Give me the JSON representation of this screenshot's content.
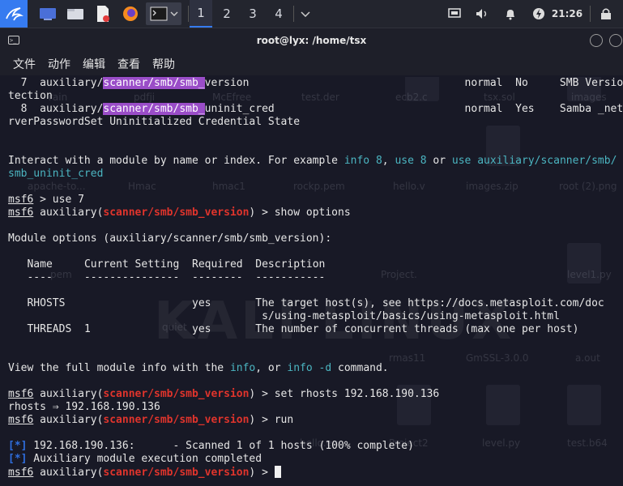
{
  "panel": {
    "workspaces": [
      "1",
      "2",
      "3",
      "4"
    ],
    "clock": "21:26"
  },
  "window": {
    "title": "root@lyx: /home/tsx",
    "menu": [
      "文件",
      "动作",
      "编辑",
      "查看",
      "帮助"
    ]
  },
  "terminal": {
    "l1_a": "  7  auxiliary/",
    "l1_b": "scanner/smb/smb_",
    "l1_c": "version                                  normal  No     SMB Version De",
    "l2": "tection",
    "l3_a": "  8  auxiliary/",
    "l3_b": "scanner/smb/smb_",
    "l3_c": "uninit_cred                              normal  Yes    Samba _netr_Se",
    "l4": "rverPasswordSet Uninitialized Credential State",
    "interact_a": "Interact with a module by name or index. For example ",
    "interact_info": "info 8",
    "interact_b": ", ",
    "interact_use": "use 8",
    "interact_c": " or ",
    "interact_use2": "use auxiliary/scanner/smb/",
    "interact_use2b": "smb_uninit_cred",
    "prompt": "msf6",
    "cmd_use7": " > use 7",
    "aux_open": " auxiliary(",
    "module": "scanner/smb/smb_version",
    "aux_close": ") > ",
    "cmd_show": "show options",
    "mod_opts": "Module options (auxiliary/scanner/smb/smb_version):",
    "th_name": "Name",
    "th_setting": "Current Setting",
    "th_required": "Required",
    "th_desc": "Description",
    "sep_row": "   ----     ---------------  --------  -----------",
    "r1_name": "RHOSTS",
    "r1_setting": "",
    "r1_required": "yes",
    "r1_desc_a": "The target host(s), see https://docs.metasploit.com/doc",
    "r1_desc_b": "s/using-metasploit/basics/using-metasploit.html",
    "r2_name": "THREADS",
    "r2_setting": "1",
    "r2_required": "yes",
    "r2_desc": "The number of concurrent threads (max one per host)",
    "view_a": "View the full module info with the ",
    "view_info": "info",
    "view_b": ", or ",
    "view_info_d": "info -d",
    "view_c": " command.",
    "cmd_set": "set rhosts 192.168.190.136",
    "rhosts_echo": "rhosts ⇒ 192.168.190.136",
    "cmd_run": "run",
    "star": "[*]",
    "scan_line": " 192.168.190.136:      - Scanned 1 of 1 hosts (100% complete)",
    "done_line": " Auxiliary module execution completed"
  },
  "desktop_labels": [
    "apache-to...",
    "Hmac",
    "hmac1",
    "rockp.pem",
    "hello.v",
    "images.zip",
    "root (2).png",
    "pem",
    "Project.",
    "level1.py",
    "quiet",
    "rmas11",
    "GmSSL-3.0.0",
    "a.out",
    "hello.en",
    "Project2",
    "level.py",
    "test.b64",
    "rain",
    "pdfji",
    "McEfree",
    "test.der",
    "ecb2.c",
    "tsx.sol",
    "images"
  ],
  "colors": {
    "accent": "#367bf0",
    "highlight": "#9a4dc8",
    "module_red": "#e0342c",
    "info_cyan": "#4bb5c1"
  }
}
